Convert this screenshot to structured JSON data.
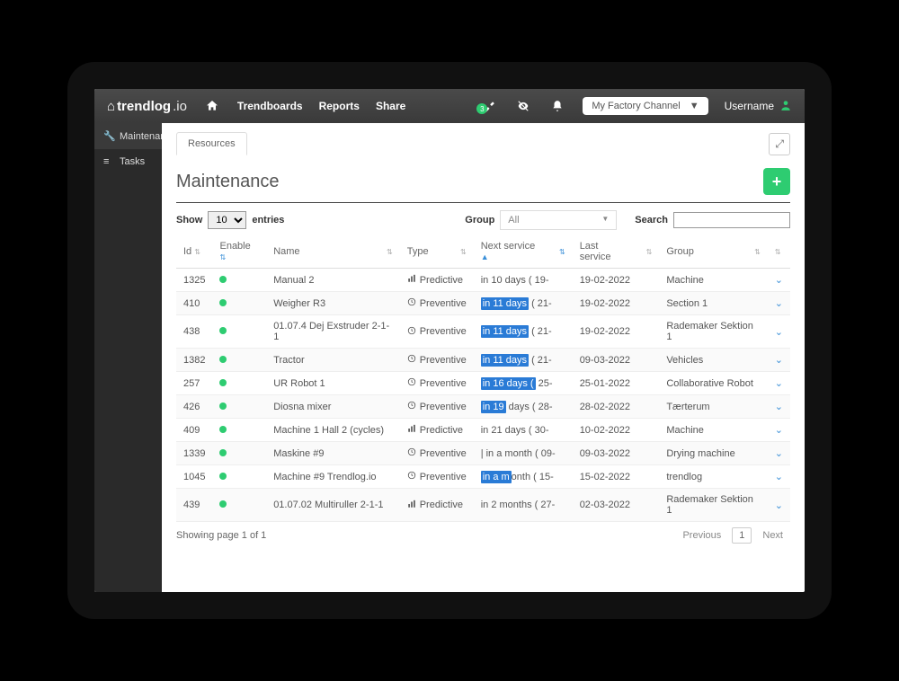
{
  "header": {
    "brand": "trendlog",
    "brand_suffix": ".io",
    "nav": {
      "boards": "Trendboards",
      "reports": "Reports",
      "share": "Share"
    },
    "badge_count": "3",
    "channel": "My Factory Channel",
    "username": "Username"
  },
  "sidebar": {
    "items": [
      {
        "label": "Maintenance"
      },
      {
        "label": "Tasks"
      }
    ]
  },
  "tabs": {
    "resources": "Resources"
  },
  "page": {
    "title": "Maintenance"
  },
  "controls": {
    "show_prefix": "Show",
    "show_value": "10",
    "show_suffix": "entries",
    "group_label": "Group",
    "group_value": "All",
    "search_label": "Search"
  },
  "columns": {
    "id": "Id",
    "enable": "Enable",
    "name": "Name",
    "type": "Type",
    "next": "Next service",
    "last": "Last service",
    "group": "Group"
  },
  "type_labels": {
    "predictive": "Predictive",
    "preventive": "Preventive"
  },
  "rows": [
    {
      "id": "1325",
      "name": "Manual 2",
      "type": "Predictive",
      "next_pre": "in 10 days",
      "next_post": " ( 19-",
      "last": "19-02-2022",
      "group": "Machine",
      "hl": false
    },
    {
      "id": "410",
      "name": "Weigher R3",
      "type": "Preventive",
      "next_pre": "in 11 days",
      "next_post": " ( 21-",
      "last": "19-02-2022",
      "group": "Section 1",
      "hl": true
    },
    {
      "id": "438",
      "name": "01.07.4 Dej Exstruder 2-1-1",
      "type": "Preventive",
      "next_pre": "in 11 days",
      "next_post": " ( 21-",
      "last": "19-02-2022",
      "group": "Rademaker Sektion 1",
      "hl": true
    },
    {
      "id": "1382",
      "name": "Tractor",
      "type": "Preventive",
      "next_pre": "in 11 days",
      "next_post": " ( 21-",
      "last": "09-03-2022",
      "group": "Vehicles",
      "hl": true
    },
    {
      "id": "257",
      "name": "UR Robot 1",
      "type": "Preventive",
      "next_pre": "in 16 days (",
      "next_post": " 25-",
      "last": "25-01-2022",
      "group": "Collaborative Robot",
      "hl": true
    },
    {
      "id": "426",
      "name": "Diosna mixer",
      "type": "Preventive",
      "next_pre": "in 19",
      "next_post": " days ( 28-",
      "last": "28-02-2022",
      "group": "Tærterum",
      "hl": true
    },
    {
      "id": "409",
      "name": "Machine 1 Hall 2 (cycles)",
      "type": "Predictive",
      "next_pre": "in 21 days",
      "next_post": " ( 30-",
      "last": "10-02-2022",
      "group": "Machine",
      "hl": false
    },
    {
      "id": "1339",
      "name": "Maskine #9",
      "type": "Preventive",
      "next_pre": "|",
      "next_post": " in a month ( 09-",
      "last": "09-03-2022",
      "group": "Drying machine",
      "hl": false
    },
    {
      "id": "1045",
      "name": "Machine #9 Trendlog.io",
      "type": "Preventive",
      "next_pre": "in a m",
      "next_post": "onth ( 15-",
      "last": "15-02-2022",
      "group": "trendlog",
      "hl": true
    },
    {
      "id": "439",
      "name": "01.07.02 Multiruller 2-1-1",
      "type": "Predictive",
      "next_pre": "in 2 months",
      "next_post": " ( 27-",
      "last": "02-03-2022",
      "group": "Rademaker Sektion 1",
      "hl": false
    }
  ],
  "pagination": {
    "info": "Showing page 1 of 1",
    "prev": "Previous",
    "page": "1",
    "next": "Next"
  }
}
